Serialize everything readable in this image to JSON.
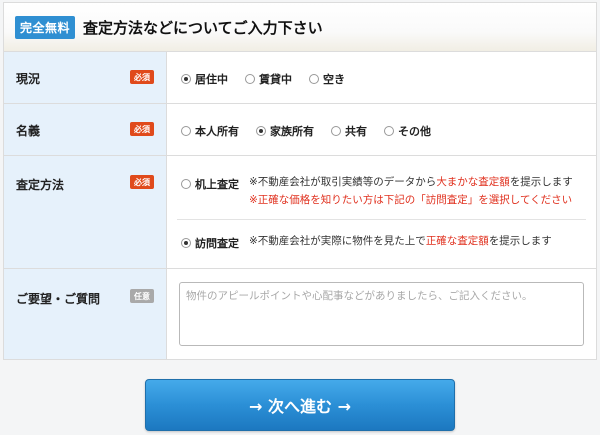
{
  "header": {
    "badge": "完全無料",
    "title": "査定方法などについてご入力下さい"
  },
  "rows": {
    "status": {
      "label": "現況",
      "badge": "必須",
      "options": [
        "居住中",
        "賃貸中",
        "空き"
      ],
      "selected": "居住中"
    },
    "ownership": {
      "label": "名義",
      "badge": "必須",
      "options": [
        "本人所有",
        "家族所有",
        "共有",
        "その他"
      ],
      "selected": "家族所有"
    },
    "method": {
      "label": "査定方法",
      "badge": "必須",
      "desk": {
        "label": "机上査定",
        "desc_prefix": "※不動産会社が取引実績等のデータから",
        "desc_red": "大まかな査定額",
        "desc_suffix": "を提示します",
        "note": "※正確な価格を知りたい方は下記の「訪問査定」を選択してください"
      },
      "visit": {
        "label": "訪問査定",
        "desc_prefix": "※不動産会社が実際に物件を見た上で",
        "desc_red": "正確な査定額",
        "desc_suffix": "を提示します"
      },
      "selected": "訪問査定"
    },
    "requests": {
      "label": "ご要望・ご質問",
      "badge": "任意",
      "placeholder": "物件のアピールポイントや心配事などがありましたら、ご記入ください。"
    }
  },
  "submit": {
    "label": "→ 次へ進む →"
  },
  "colors": {
    "accent": "#2f8fd2",
    "required": "#e04a1b",
    "optional": "#a9a9a9",
    "highlight": "#e0301e",
    "label_bg": "#e6f1fb"
  }
}
